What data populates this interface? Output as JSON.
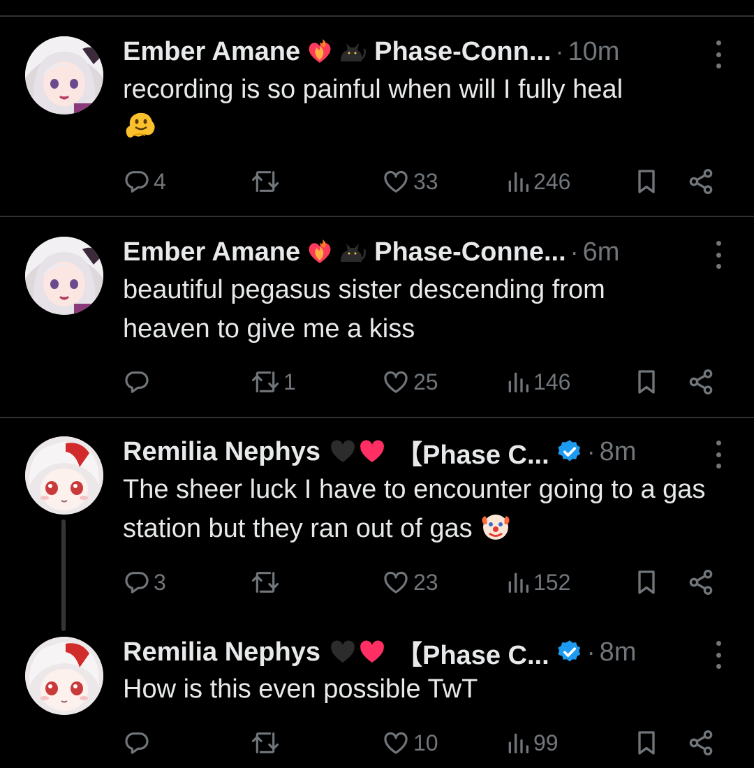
{
  "colors": {
    "background": "#000000",
    "text": "#e7e9ea",
    "muted": "#71767b",
    "divider": "#2f3336",
    "verified": "#1d9bf0"
  },
  "tweets": [
    {
      "name": "Ember Amane",
      "handle": "Phase-Conn...",
      "dot": "·",
      "time": "10m",
      "text": "recording is so painful when will I fully heal",
      "trailing_emoji": "melting-face",
      "name_emojis": [
        "heart-on-fire",
        "black-cat"
      ],
      "verified": false,
      "replies": "4",
      "retweets": "",
      "likes": "33",
      "views": "246"
    },
    {
      "name": "Ember Amane",
      "handle": "Phase-Conne...",
      "dot": "·",
      "time": "6m",
      "text": "beautiful pegasus sister descending from heaven to give me a kiss",
      "name_emojis": [
        "heart-on-fire",
        "black-cat"
      ],
      "verified": false,
      "replies": "",
      "retweets": "1",
      "likes": "25",
      "views": "146"
    },
    {
      "name": "Remilia Nephys",
      "handle": "【Phase C...",
      "dot": "·",
      "time": "8m",
      "text": "The sheer luck I have to encounter going to a gas station but they ran out of gas",
      "trailing_emoji": "clown-face",
      "name_emojis": [
        "black-heart",
        "red-heart"
      ],
      "verified": true,
      "replies": "3",
      "retweets": "",
      "likes": "23",
      "views": "152"
    },
    {
      "name": "Remilia Nephys",
      "handle": "【Phase C...",
      "dot": "·",
      "time": "8m",
      "text": "How is this even possible TwT",
      "name_emojis": [
        "black-heart",
        "red-heart"
      ],
      "verified": true,
      "replies": "",
      "retweets": "",
      "likes": "10",
      "views": "99"
    }
  ]
}
